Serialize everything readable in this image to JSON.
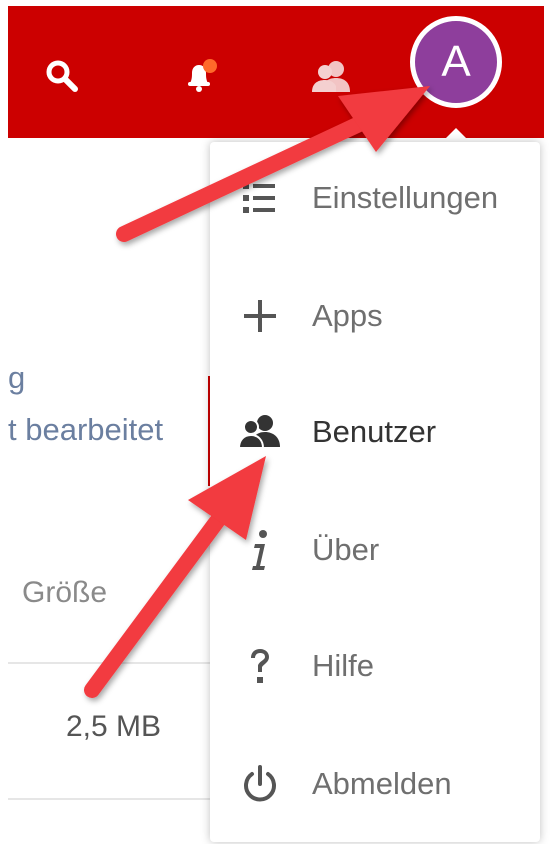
{
  "header": {
    "background": "#cc0000",
    "icons": [
      "search-icon",
      "notification-bell-icon",
      "contacts-icon"
    ],
    "notification_dot_color": "#ff6a2a",
    "avatar": {
      "initial": "A",
      "color": "#8e3e9c"
    }
  },
  "background_page": {
    "title_fragment": "g",
    "subtitle_fragment": "t bearbeitet",
    "column_size": "Größe",
    "row_size": "2,5 MB"
  },
  "menu": {
    "items": [
      {
        "label": "Einstellungen",
        "icon": "settings-list-icon"
      },
      {
        "label": "Apps",
        "icon": "plus-icon"
      },
      {
        "label": "Benutzer",
        "icon": "users-icon",
        "active": true
      },
      {
        "label": "Über",
        "icon": "info-icon"
      },
      {
        "label": "Hilfe",
        "icon": "question-icon"
      },
      {
        "label": "Abmelden",
        "icon": "power-icon"
      }
    ]
  },
  "annotations": {
    "arrow_color": "#f23a3f",
    "arrow_count": 2
  }
}
